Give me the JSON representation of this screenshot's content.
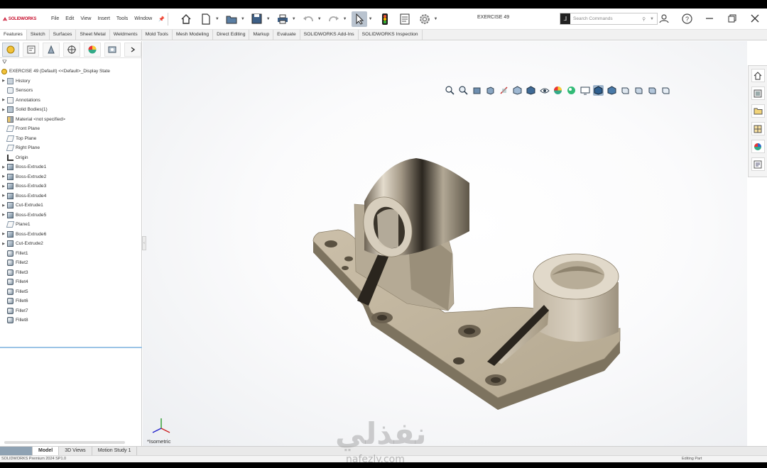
{
  "app": {
    "logo_text": "SOLIDWORKS",
    "document_title": "EXERCISE 49"
  },
  "menu": [
    "File",
    "Edit",
    "View",
    "Insert",
    "Tools",
    "Window"
  ],
  "search": {
    "placeholder": "Search Commands"
  },
  "ribbon_tabs": [
    {
      "label": "Features",
      "active": true
    },
    {
      "label": "Sketch"
    },
    {
      "label": "Surfaces"
    },
    {
      "label": "Sheet Metal"
    },
    {
      "label": "Weldments"
    },
    {
      "label": "Mold Tools"
    },
    {
      "label": "Mesh Modeling"
    },
    {
      "label": "Direct Editing"
    },
    {
      "label": "Markup"
    },
    {
      "label": "Evaluate"
    },
    {
      "label": "SOLIDWORKS Add-Ins"
    },
    {
      "label": "SOLIDWORKS Inspection"
    }
  ],
  "tree": {
    "root": "EXERCISE 49 (Default) <<Default>_Display State",
    "items": [
      {
        "label": "History",
        "icon": "folder",
        "expand": true
      },
      {
        "label": "Sensors",
        "icon": "sensor",
        "expand": false
      },
      {
        "label": "Annotations",
        "icon": "annot",
        "expand": true
      },
      {
        "label": "Solid Bodies(1)",
        "icon": "solid",
        "expand": true
      },
      {
        "label": "Material <not specified>",
        "icon": "mat",
        "expand": false
      },
      {
        "label": "Front Plane",
        "icon": "plane",
        "expand": false
      },
      {
        "label": "Top Plane",
        "icon": "plane",
        "expand": false
      },
      {
        "label": "Right Plane",
        "icon": "plane",
        "expand": false
      },
      {
        "label": "Origin",
        "icon": "origin",
        "expand": false
      },
      {
        "label": "Boss-Extrude1",
        "icon": "feat",
        "expand": true
      },
      {
        "label": "Boss-Extrude2",
        "icon": "feat",
        "expand": true
      },
      {
        "label": "Boss-Extrude3",
        "icon": "feat",
        "expand": true
      },
      {
        "label": "Boss-Extrude4",
        "icon": "feat",
        "expand": true
      },
      {
        "label": "Cut-Extrude1",
        "icon": "cut",
        "expand": true
      },
      {
        "label": "Boss-Extrude5",
        "icon": "feat",
        "expand": true
      },
      {
        "label": "Plane1",
        "icon": "plane",
        "expand": false
      },
      {
        "label": "Boss-Extrude6",
        "icon": "feat",
        "expand": true
      },
      {
        "label": "Cut-Extrude2",
        "icon": "cut",
        "expand": true
      },
      {
        "label": "Fillet1",
        "icon": "fillet",
        "expand": false
      },
      {
        "label": "Fillet2",
        "icon": "fillet",
        "expand": false
      },
      {
        "label": "Fillet3",
        "icon": "fillet",
        "expand": false
      },
      {
        "label": "Fillet4",
        "icon": "fillet",
        "expand": false
      },
      {
        "label": "Fillet5",
        "icon": "fillet",
        "expand": false
      },
      {
        "label": "Fillet6",
        "icon": "fillet",
        "expand": false
      },
      {
        "label": "Fillet7",
        "icon": "fillet",
        "expand": false
      },
      {
        "label": "Fillet8",
        "icon": "fillet",
        "expand": false
      }
    ]
  },
  "viewport": {
    "orientation": "*Isometric"
  },
  "bottom_tabs": [
    {
      "label": "Model",
      "active": true
    },
    {
      "label": "3D Views"
    },
    {
      "label": "Motion Study 1"
    }
  ],
  "status": {
    "left": "SOLIDWORKS Premium 2024 SP1.0",
    "right": "Editing Part"
  },
  "watermark": {
    "arabic": "نفذلي",
    "latin": "nafezly.com"
  },
  "colors": {
    "accent": "#c8102e",
    "part": "#c9bfae",
    "selection": "#9fb5cc"
  }
}
